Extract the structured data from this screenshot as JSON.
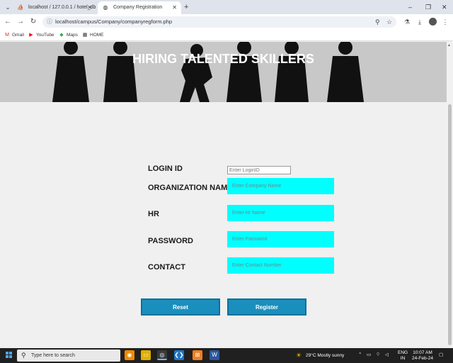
{
  "browser": {
    "tabs": [
      {
        "title": "localhost / 127.0.0.1 / hotel_db",
        "icon": "phpmyadmin-icon"
      },
      {
        "title": "Company Registration",
        "icon": "globe-icon"
      }
    ],
    "url": "localhost/campus/Company/companyregform.php",
    "bookmarks": [
      {
        "label": "Gmail",
        "icon": "gmail-icon"
      },
      {
        "label": "YouTube",
        "icon": "youtube-icon"
      },
      {
        "label": "Maps",
        "icon": "maps-icon"
      },
      {
        "label": "HOME",
        "icon": "folder-icon"
      }
    ]
  },
  "banner": {
    "title": "HIRING TALENTED SKILLERS"
  },
  "form": {
    "login_id": {
      "label": "LOGIN ID",
      "placeholder": "Enter LoginID"
    },
    "organization_name": {
      "label": "ORGANIZATION NAME",
      "placeholder": "Enter Company Name"
    },
    "hr": {
      "label": "HR",
      "placeholder": "Enter Hr Name"
    },
    "password": {
      "label": "PASSWORD",
      "placeholder": "Enter Password"
    },
    "contact": {
      "label": "CONTACT",
      "placeholder": "Enter Contact Number"
    },
    "reset_label": "Reset",
    "register_label": "Register"
  },
  "colors": {
    "field_fill": "#00ffff",
    "button_fill": "#1a8fbd"
  },
  "taskbar": {
    "search_placeholder": "Type here to search",
    "weather": "29°C  Mostly sunny",
    "language_top": "ENG",
    "language_bottom": "IN",
    "time": "10:07 AM",
    "date": "24-Feb-24"
  }
}
